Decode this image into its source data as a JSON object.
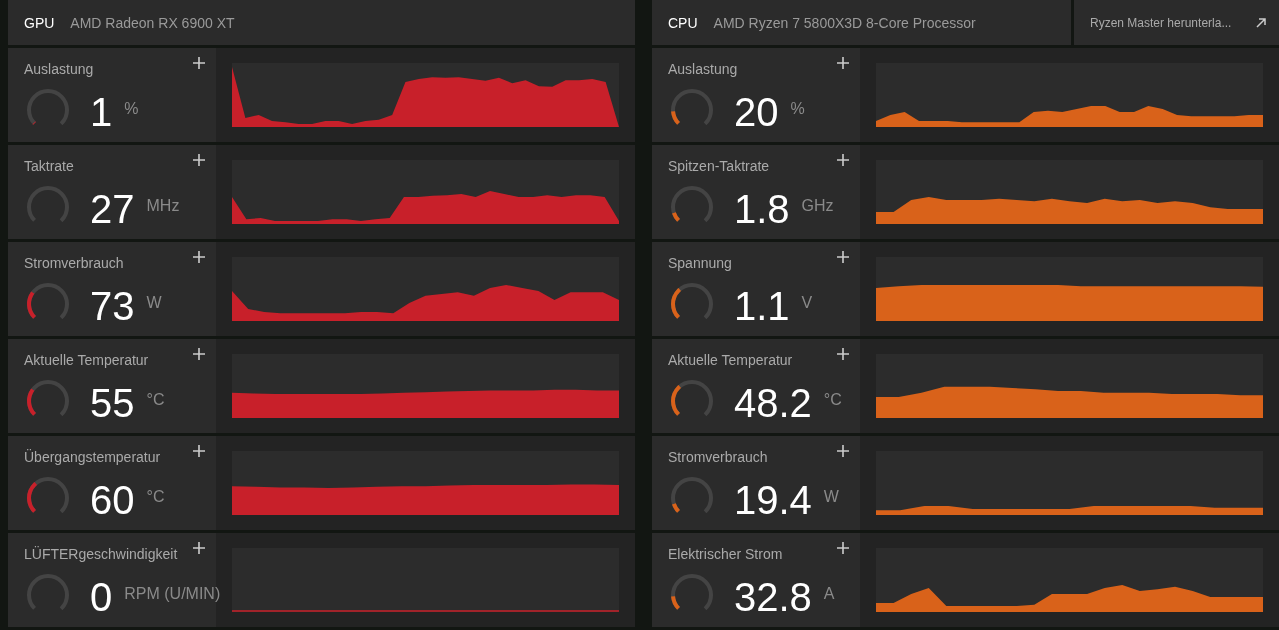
{
  "panels": [
    {
      "type": "GPU",
      "name": "AMD Radeon RX 6900 XT",
      "color": "#c8202a",
      "metrics": [
        {
          "label": "Auslastung",
          "value": "1",
          "unit": "%",
          "level": 0.01
        },
        {
          "label": "Taktrate",
          "value": "27",
          "unit": "MHz",
          "level": 0.0
        },
        {
          "label": "Stromverbrauch",
          "value": "73",
          "unit": "W",
          "level": 0.3
        },
        {
          "label": "Aktuelle Temperatur",
          "value": "55",
          "unit": "°C",
          "level": 0.3
        },
        {
          "label": "Übergangstemperatur",
          "value": "60",
          "unit": "°C",
          "level": 0.35
        },
        {
          "label": "LÜFTERgeschwindigkeit",
          "value": "0",
          "unit": "RPM (U/MIN)",
          "level": 0.0
        }
      ]
    },
    {
      "type": "CPU",
      "name": "AMD Ryzen 7 5800X3D 8-Core Processor",
      "link": "Ryzen Master herunterla...",
      "color": "#d9621a",
      "metrics": [
        {
          "label": "Auslastung",
          "value": "20",
          "unit": "%",
          "level": 0.15
        },
        {
          "label": "Spitzen-Taktrate",
          "value": "1.8",
          "unit": "GHz",
          "level": 0.1
        },
        {
          "label": "Spannung",
          "value": "1.1",
          "unit": "V",
          "level": 0.35
        },
        {
          "label": "Aktuelle Temperatur",
          "value": "48.2",
          "unit": "°C",
          "level": 0.35
        },
        {
          "label": "Stromverbrauch",
          "value": "19.4",
          "unit": "W",
          "level": 0.1
        },
        {
          "label": "Elektrischer Strom",
          "value": "32.8",
          "unit": "A",
          "level": 0.15
        }
      ]
    }
  ]
}
